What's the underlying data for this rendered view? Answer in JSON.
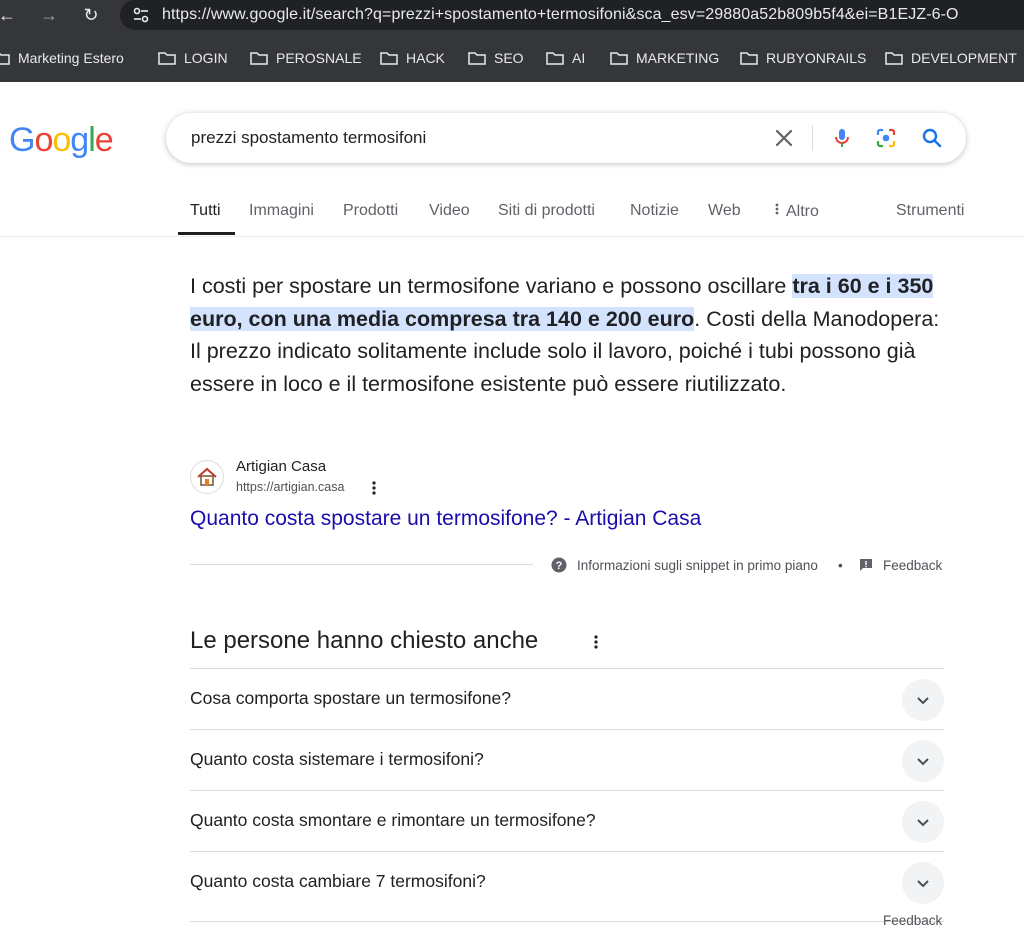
{
  "browser": {
    "url": "https://www.google.it/search?q=prezzi+spostamento+termosifoni&sca_esv=29880a52b809b5f4&ei=B1EJZ-6-O",
    "bookmarks": [
      "Marketing Estero",
      "LOGIN",
      "PEROSNALE",
      "HACK",
      "SEO",
      "AI",
      "MARKETING",
      "RUBYONRAILS",
      "DEVELOPMENT"
    ]
  },
  "google": {
    "logo_letters": [
      "G",
      "o",
      "o",
      "g",
      "l",
      "e"
    ],
    "logo_colors": [
      "#4285F4",
      "#EA4335",
      "#FBBC05",
      "#4285F4",
      "#34A853",
      "#EA4335"
    ],
    "query": "prezzi spostamento termosifoni"
  },
  "tabs": [
    "Tutti",
    "Immagini",
    "Prodotti",
    "Video",
    "Siti di prodotti",
    "Notizie",
    "Web",
    "Altro",
    "Strumenti"
  ],
  "snippet": {
    "text_before": "I costi per spostare un termosifone variano e possono oscillare ",
    "highlight": "tra i 60 e i 350 euro, con una media compresa tra 140 e 200 euro",
    "text_after": ". Costi della Manodopera: Il prezzo indicato solitamente include solo il lavoro, poiché i tubi possono già essere in loco e il termosifone esistente può essere riutilizzato.",
    "source_name": "Artigian Casa",
    "source_url": "https://artigian.casa",
    "link_title": "Quanto costa spostare un termosifone? - Artigian Casa",
    "info_label": "Informazioni sugli snippet in primo piano",
    "feedback": "Feedback",
    "separator": "•"
  },
  "paa": {
    "title": "Le persone hanno chiesto anche",
    "questions": [
      "Cosa comporta spostare un termosifone?",
      "Quanto costa sistemare i termosifoni?",
      "Quanto costa smontare e rimontare un termosifone?",
      "Quanto costa cambiare 7 termosifoni?"
    ],
    "feedback": "Feedback"
  }
}
